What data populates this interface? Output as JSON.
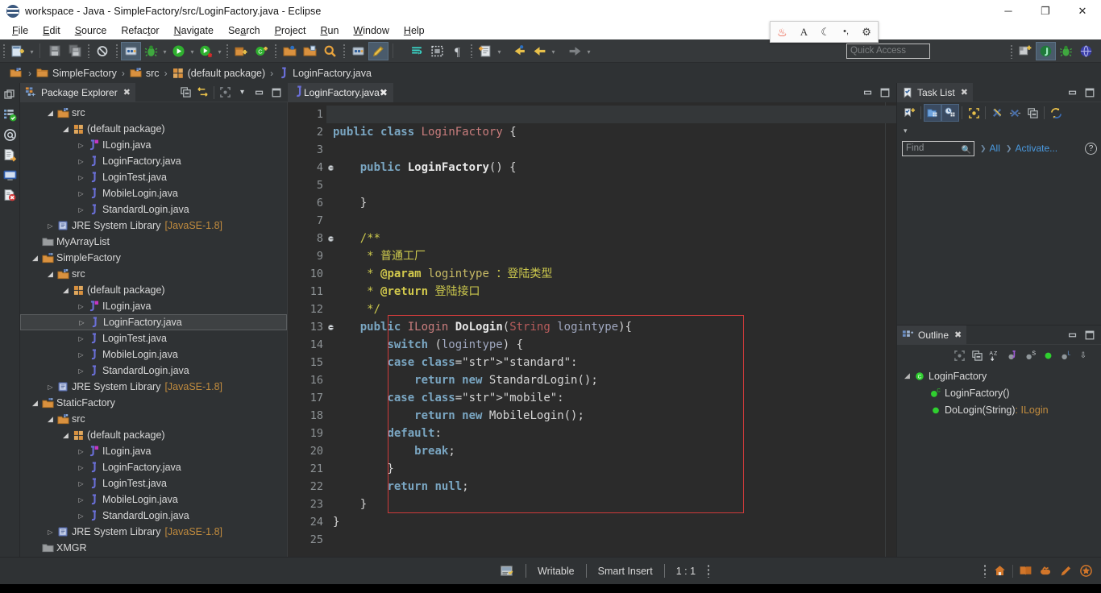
{
  "window": {
    "title": "workspace - Java - SimpleFactory/src/LoginFactory.java - Eclipse",
    "app_icon": "eclipse-icon",
    "minimize": "─",
    "maximize": "❐",
    "close": "✕"
  },
  "menubar": {
    "items": [
      {
        "label": "File",
        "mnemonic": "F"
      },
      {
        "label": "Edit",
        "mnemonic": "E"
      },
      {
        "label": "Source",
        "mnemonic": "S"
      },
      {
        "label": "Refactor",
        "mnemonic": "t"
      },
      {
        "label": "Navigate",
        "mnemonic": "N"
      },
      {
        "label": "Search",
        "mnemonic": "a"
      },
      {
        "label": "Project",
        "mnemonic": "P"
      },
      {
        "label": "Run",
        "mnemonic": "R"
      },
      {
        "label": "Window",
        "mnemonic": "W"
      },
      {
        "label": "Help",
        "mnemonic": "H"
      }
    ]
  },
  "ime_bar": {
    "icons": [
      "baidu-paw-icon",
      "letter-a-icon",
      "moon-icon",
      "punctuation-icon",
      "gear-icon"
    ]
  },
  "toolbar": {
    "quick_access_placeholder": "Quick Access",
    "buttons": [
      "new-wizard-icon",
      "save-icon",
      "save-all-icon",
      "skip-breakpoints-icon",
      "toggle-debug-icon",
      "debug-icon",
      "run-icon",
      "coverage-icon",
      "new-java-project-icon",
      "new-java-class-icon",
      "open-type-icon",
      "open-resource-icon",
      "search-icon",
      "debug-perspective-icon",
      "edit-icon",
      "next-annotation-icon",
      "block-selection-icon",
      "show-whitespace-icon",
      "last-edit-location-icon",
      "back-icon",
      "forward-icon",
      "arrow-right-icon"
    ],
    "perspective_buttons": [
      "open-perspective-icon",
      "java-perspective-icon",
      "debug-perspective-icon",
      "web-perspective-icon"
    ]
  },
  "breadcrumb": {
    "items": [
      {
        "label": "SimpleFactory",
        "icon": "project-folder-icon"
      },
      {
        "label": "src",
        "icon": "source-folder-icon"
      },
      {
        "label": "(default package)",
        "icon": "package-icon"
      },
      {
        "label": "LoginFactory.java",
        "icon": "java-file-icon"
      }
    ],
    "separator": "›"
  },
  "left_shortcut_bar": {
    "icons": [
      "restore-icon",
      "package-explorer-icon",
      "javadoc-icon",
      "declaration-icon",
      "console-icon",
      "problems-icon"
    ]
  },
  "package_explorer": {
    "title": "Package Explorer",
    "close_label": "✖",
    "tools": [
      "collapse-all-icon",
      "link-with-editor-icon",
      "focus-icon",
      "view-menu-icon",
      "minimize-icon",
      "maximize-icon"
    ],
    "tree": [
      {
        "depth": 1,
        "twisty": "open",
        "icon": "source-folder-icon",
        "label": "src",
        "suffix": ""
      },
      {
        "depth": 2,
        "twisty": "open",
        "icon": "package-icon",
        "label": "(default package)",
        "suffix": ""
      },
      {
        "depth": 3,
        "twisty": "closed",
        "icon": "java-interface-icon",
        "label": "ILogin.java",
        "suffix": ""
      },
      {
        "depth": 3,
        "twisty": "closed",
        "icon": "java-file-icon",
        "label": "LoginFactory.java",
        "suffix": ""
      },
      {
        "depth": 3,
        "twisty": "closed",
        "icon": "java-file-icon",
        "label": "LoginTest.java",
        "suffix": ""
      },
      {
        "depth": 3,
        "twisty": "closed",
        "icon": "java-file-icon",
        "label": "MobileLogin.java",
        "suffix": ""
      },
      {
        "depth": 3,
        "twisty": "closed",
        "icon": "java-file-icon",
        "label": "StandardLogin.java",
        "suffix": ""
      },
      {
        "depth": 1,
        "twisty": "closed",
        "icon": "library-icon",
        "label": "JRE System Library",
        "suffix": "[JavaSE-1.8]"
      },
      {
        "depth": 0,
        "twisty": "none",
        "icon": "closed-project-icon",
        "label": "MyArrayList",
        "suffix": ""
      },
      {
        "depth": 0,
        "twisty": "open",
        "icon": "project-folder-icon",
        "label": "SimpleFactory",
        "suffix": ""
      },
      {
        "depth": 1,
        "twisty": "open",
        "icon": "source-folder-icon",
        "label": "src",
        "suffix": ""
      },
      {
        "depth": 2,
        "twisty": "open",
        "icon": "package-icon",
        "label": "(default package)",
        "suffix": ""
      },
      {
        "depth": 3,
        "twisty": "closed",
        "icon": "java-interface-icon",
        "label": "ILogin.java",
        "suffix": ""
      },
      {
        "depth": 3,
        "twisty": "closed",
        "icon": "java-file-icon",
        "label": "LoginFactory.java",
        "suffix": "",
        "selected": true
      },
      {
        "depth": 3,
        "twisty": "closed",
        "icon": "java-file-icon",
        "label": "LoginTest.java",
        "suffix": ""
      },
      {
        "depth": 3,
        "twisty": "closed",
        "icon": "java-file-icon",
        "label": "MobileLogin.java",
        "suffix": ""
      },
      {
        "depth": 3,
        "twisty": "closed",
        "icon": "java-file-icon",
        "label": "StandardLogin.java",
        "suffix": ""
      },
      {
        "depth": 1,
        "twisty": "closed",
        "icon": "library-icon",
        "label": "JRE System Library",
        "suffix": "[JavaSE-1.8]"
      },
      {
        "depth": 0,
        "twisty": "open",
        "icon": "project-folder-icon",
        "label": "StaticFactory",
        "suffix": ""
      },
      {
        "depth": 1,
        "twisty": "open",
        "icon": "source-folder-icon",
        "label": "src",
        "suffix": ""
      },
      {
        "depth": 2,
        "twisty": "open",
        "icon": "package-icon",
        "label": "(default package)",
        "suffix": ""
      },
      {
        "depth": 3,
        "twisty": "closed",
        "icon": "java-interface-icon",
        "label": "ILogin.java",
        "suffix": ""
      },
      {
        "depth": 3,
        "twisty": "closed",
        "icon": "java-file-icon",
        "label": "LoginFactory.java",
        "suffix": ""
      },
      {
        "depth": 3,
        "twisty": "closed",
        "icon": "java-file-icon",
        "label": "LoginTest.java",
        "suffix": ""
      },
      {
        "depth": 3,
        "twisty": "closed",
        "icon": "java-file-icon",
        "label": "MobileLogin.java",
        "suffix": ""
      },
      {
        "depth": 3,
        "twisty": "closed",
        "icon": "java-file-icon",
        "label": "StandardLogin.java",
        "suffix": ""
      },
      {
        "depth": 1,
        "twisty": "closed",
        "icon": "library-icon",
        "label": "JRE System Library",
        "suffix": "[JavaSE-1.8]"
      },
      {
        "depth": 0,
        "twisty": "none",
        "icon": "closed-project-icon",
        "label": "XMGR",
        "suffix": ""
      }
    ]
  },
  "editor": {
    "tab_label": "LoginFactory.java",
    "tab_icon": "java-file-icon",
    "tab_close": "✖",
    "tools": [
      "minimize-icon",
      "maximize-icon"
    ],
    "cursor_line": 1,
    "fold_lines": [
      4,
      8,
      13
    ],
    "line_numbers": [
      1,
      2,
      3,
      4,
      5,
      6,
      7,
      8,
      9,
      10,
      11,
      12,
      13,
      14,
      15,
      16,
      17,
      18,
      19,
      20,
      21,
      22,
      23,
      24,
      25
    ],
    "lines": [
      {
        "n": 1,
        "text": ""
      },
      {
        "n": 2,
        "text": "public class LoginFactory {"
      },
      {
        "n": 3,
        "text": ""
      },
      {
        "n": 4,
        "text": "    public LoginFactory() {"
      },
      {
        "n": 5,
        "text": ""
      },
      {
        "n": 6,
        "text": "    }"
      },
      {
        "n": 7,
        "text": ""
      },
      {
        "n": 8,
        "text": "    /**"
      },
      {
        "n": 9,
        "text": "     * 普通工厂"
      },
      {
        "n": 10,
        "text": "     * @param logintype ：登陆类型"
      },
      {
        "n": 11,
        "text": "     * @return 登陆接口"
      },
      {
        "n": 12,
        "text": "     */"
      },
      {
        "n": 13,
        "text": "    public ILogin DoLogin(String logintype){"
      },
      {
        "n": 14,
        "text": "        switch (logintype) {"
      },
      {
        "n": 15,
        "text": "        case \"standard\":"
      },
      {
        "n": 16,
        "text": "            return new StandardLogin();"
      },
      {
        "n": 17,
        "text": "        case \"mobile\":"
      },
      {
        "n": 18,
        "text": "            return new MobileLogin();"
      },
      {
        "n": 19,
        "text": "        default:"
      },
      {
        "n": 20,
        "text": "            break;"
      },
      {
        "n": 21,
        "text": "        }"
      },
      {
        "n": 22,
        "text": "        return null;"
      },
      {
        "n": 23,
        "text": "    }"
      },
      {
        "n": 24,
        "text": "}"
      },
      {
        "n": 25,
        "text": ""
      }
    ]
  },
  "task_list": {
    "title": "Task List",
    "close_label": "✖",
    "tools": [
      "new-task-icon",
      "categorize-icon",
      "schedule-icon",
      "focus-icon",
      "filter-completed-icon",
      "filter-icon",
      "collapse-all-icon",
      "synchronize-icon",
      "minimize-icon",
      "maximize-icon"
    ],
    "find_placeholder": "Find",
    "find_value": "",
    "find_icon": "search-icon",
    "all_label": "All",
    "activate_label": "Activate...",
    "help_label": "?"
  },
  "outline": {
    "title": "Outline",
    "close_label": "✖",
    "tools": [
      "focus-icon",
      "collapse-all-icon",
      "sort-icon",
      "hide-fields-icon",
      "hide-static-icon",
      "hide-nonpublic-icon",
      "hide-local-icon",
      "view-menu-icon",
      "minimize-icon",
      "maximize-icon"
    ],
    "items": [
      {
        "depth": 0,
        "twisty": "open",
        "icon": "class-icon",
        "label": "LoginFactory",
        "type": ""
      },
      {
        "depth": 1,
        "twisty": "none",
        "icon": "constructor-icon",
        "label": "LoginFactory()",
        "type": ""
      },
      {
        "depth": 1,
        "twisty": "none",
        "icon": "method-icon",
        "label": "DoLogin(String)",
        "type": " : ILogin"
      }
    ]
  },
  "statusbar": {
    "icon": "writable-state-icon",
    "writable": "Writable",
    "insert_mode": "Smart Insert",
    "position": "1 : 1",
    "right_icons": [
      "home-icon",
      "book-icon",
      "hand-icon",
      "pencil-icon",
      "shield-icon"
    ]
  },
  "colors": {
    "window_titlebar": "#ffffff",
    "chrome": "#2f3234",
    "editor_bg": "#2b2b2b",
    "panel_tab": "#3a3d40",
    "selection": "#3e4143",
    "error_border": "#cf3b3b",
    "keyword": "#cc7832",
    "keyword_blue": "#7aa6c2",
    "string": "#e8bf6a",
    "comment": "#cdc94d",
    "type": "#c97d7d",
    "link": "#4a9ae0",
    "library_suffix": "#c08b3e",
    "accent_green": "#3fbf3f"
  }
}
